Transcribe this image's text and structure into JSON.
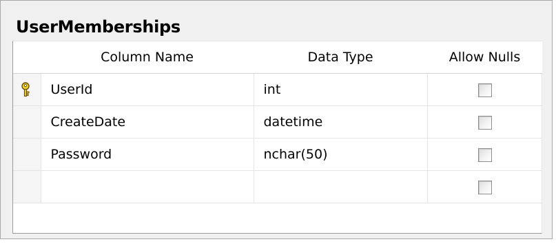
{
  "table": {
    "name": "UserMemberships",
    "headers": {
      "column_name": "Column Name",
      "data_type": "Data Type",
      "allow_nulls": "Allow Nulls"
    },
    "rows": [
      {
        "column_name": "UserId",
        "data_type": "int",
        "allow_nulls": false,
        "primary_key": true,
        "key_icon": "primary-key-icon"
      },
      {
        "column_name": "CreateDate",
        "data_type": "datetime",
        "allow_nulls": false,
        "primary_key": false
      },
      {
        "column_name": "Password",
        "data_type": "nchar(50)",
        "allow_nulls": false,
        "primary_key": false
      },
      {
        "column_name": "",
        "data_type": "",
        "allow_nulls": false,
        "primary_key": false
      }
    ]
  },
  "colors": {
    "key_gold": "#e0c020",
    "frame_background": "#f0f0f0"
  }
}
